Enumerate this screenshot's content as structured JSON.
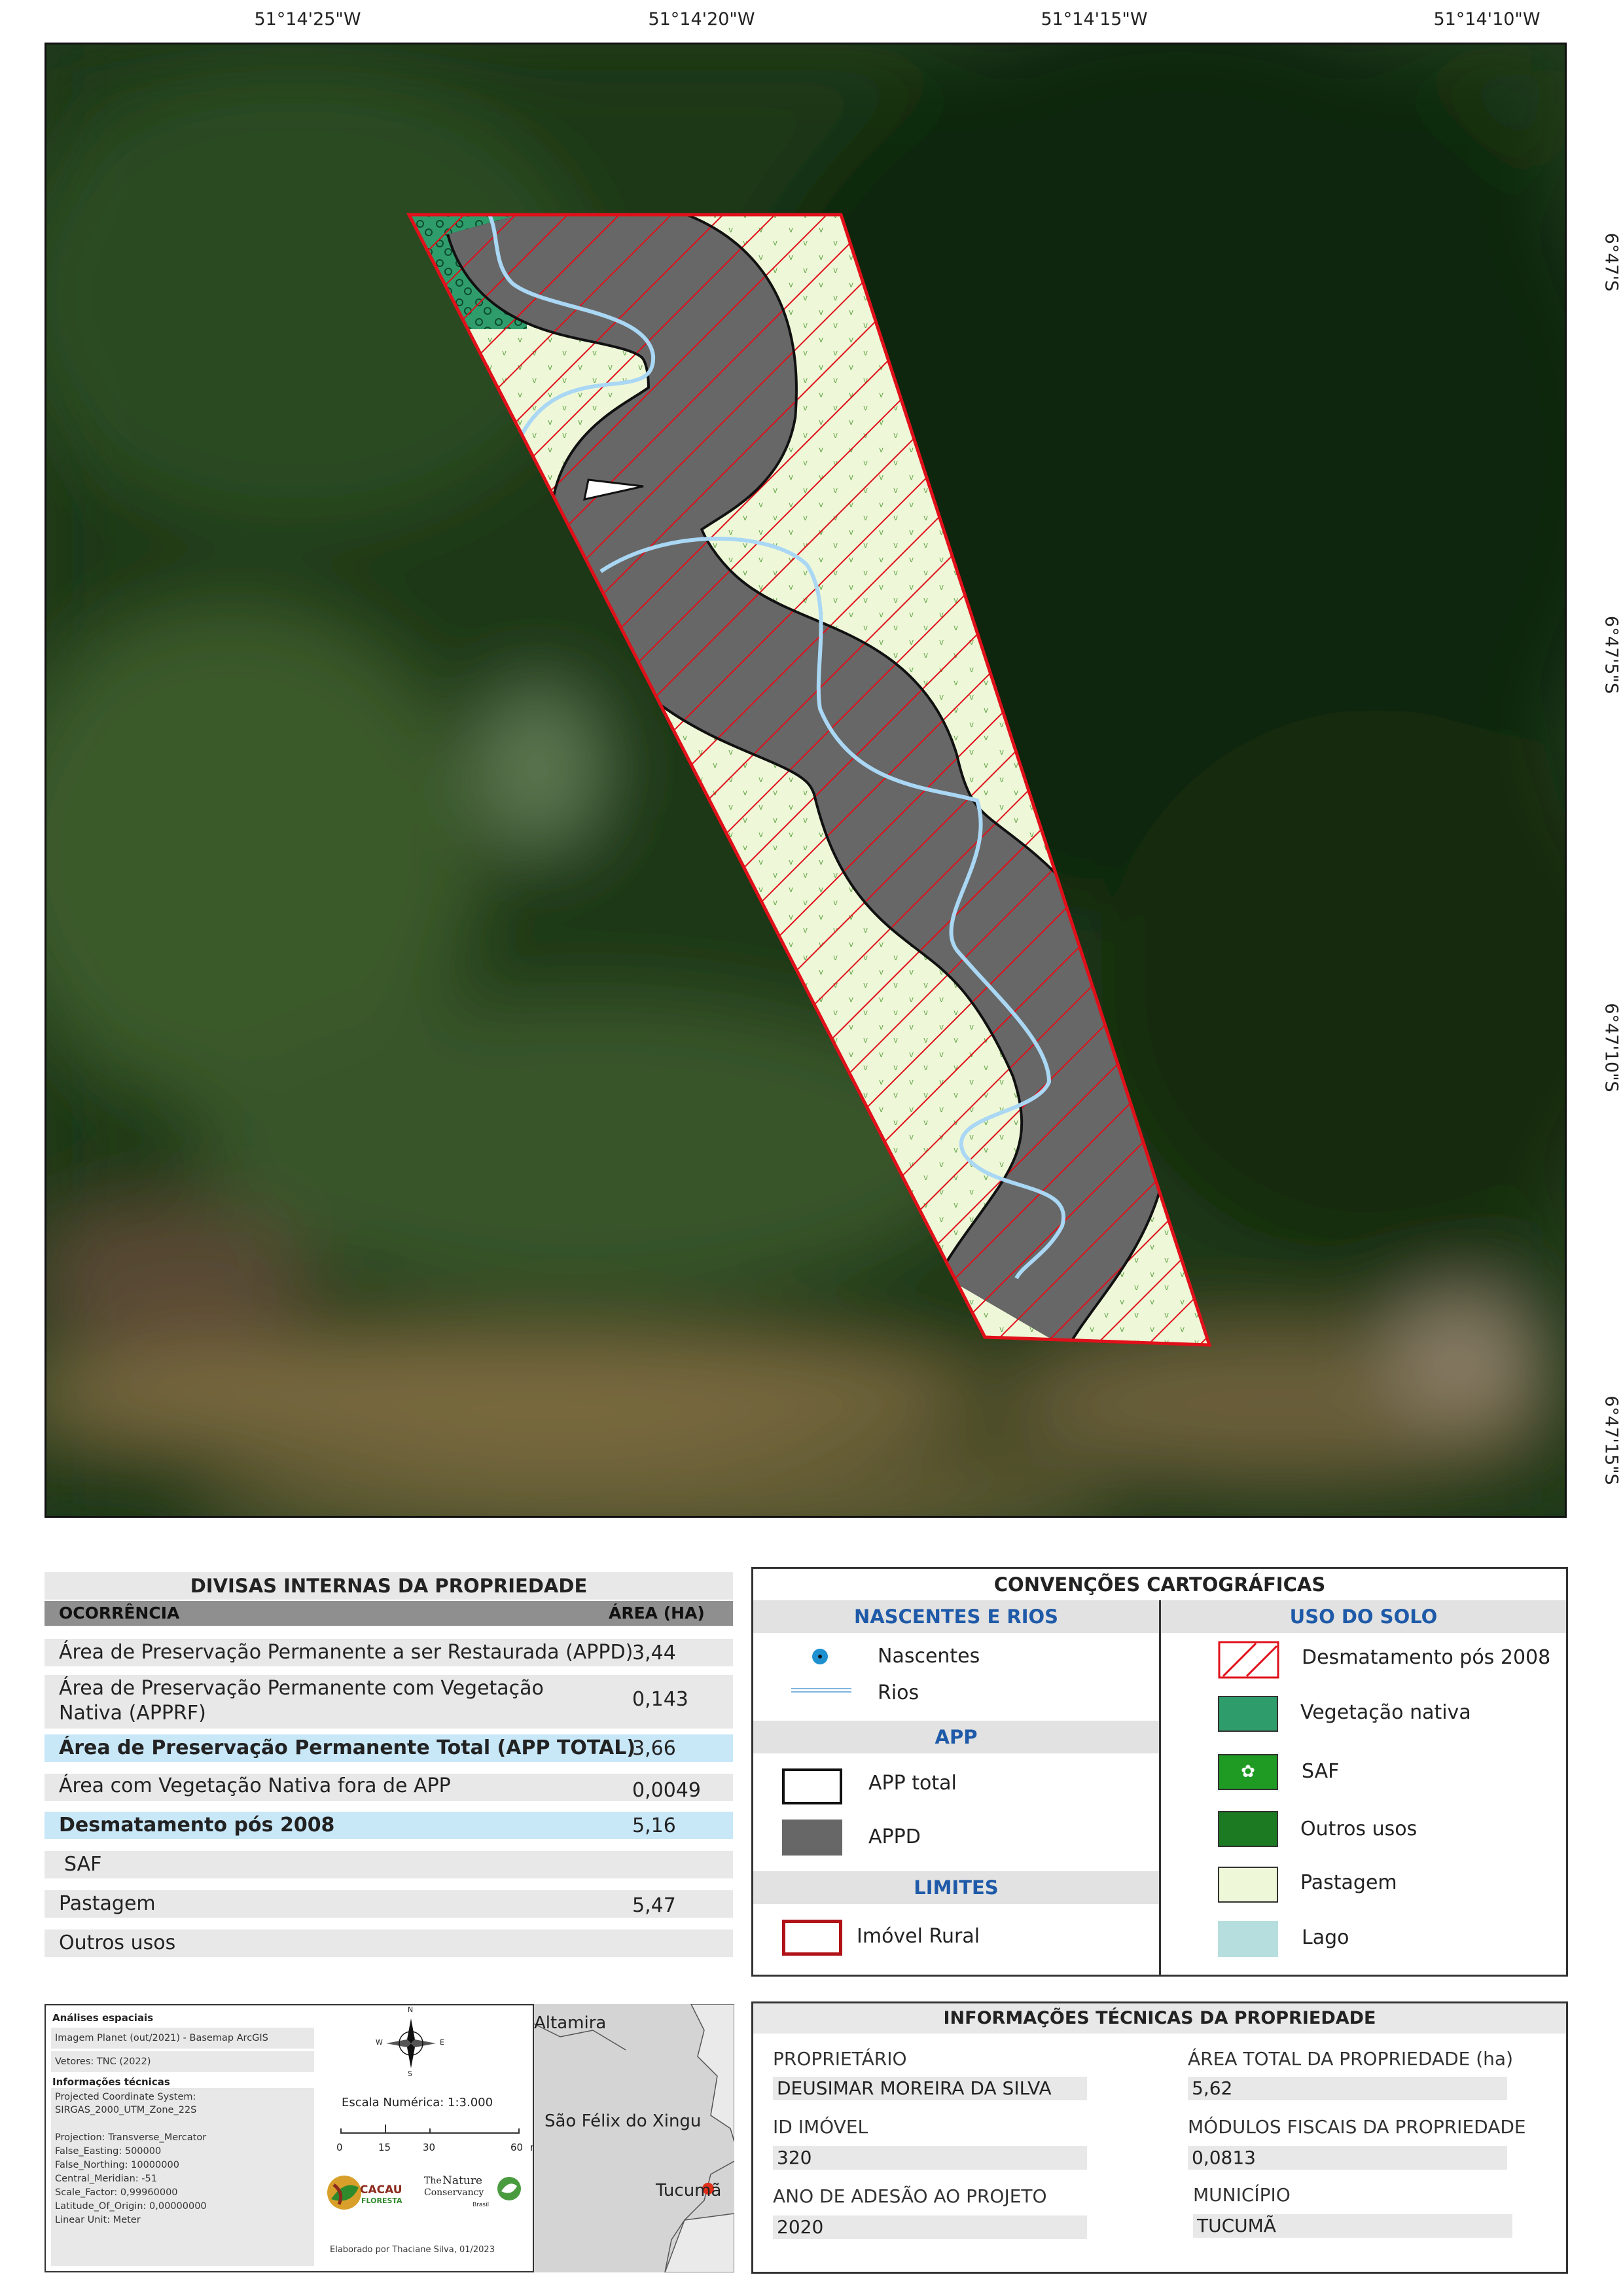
{
  "coordinates": {
    "longitude_labels": [
      "51°14'25\"W",
      "51°14'20\"W",
      "51°14'15\"W",
      "51°14'10\"W"
    ],
    "latitude_labels": [
      "6°47'S",
      "6°47'5\"S",
      "6°47'10\"S",
      "6°47'15\"S"
    ]
  },
  "divisas": {
    "title": "DIVISAS INTERNAS DA PROPRIEDADE",
    "col_ocorrencia": "OCORRÊNCIA",
    "col_area": "ÁREA (HA)",
    "rows": [
      {
        "label": "Área de Preservação Permanente a ser Restaurada (APPD)",
        "value": "3,44"
      },
      {
        "label": "Área de Preservação Permanente com Vegetação Nativa (APPRF)",
        "value": "0,143"
      },
      {
        "label": "Área de Preservação Permanente Total (APP TOTAL)",
        "value": "3,66"
      },
      {
        "label": "Área com Vegetação Nativa fora de APP",
        "value": "0,0049"
      },
      {
        "label": "Desmatamento pós 2008",
        "value": "5,16"
      },
      {
        "label": "SAF",
        "value": ""
      },
      {
        "label": "Pastagem",
        "value": "5,47"
      },
      {
        "label": "Outros usos",
        "value": ""
      }
    ]
  },
  "convencoes": {
    "title": "CONVENÇÕES CARTOGRÁFICAS",
    "nascentes_rios": "NASCENTES E RIOS",
    "nascentes": "Nascentes",
    "rios": "Rios",
    "app": "APP",
    "app_total": "APP total",
    "appd": "APPD",
    "limites": "LIMITES",
    "imovel_rural": "Imóvel Rural",
    "uso_do_solo": "USO DO SOLO",
    "uso_items": [
      "Desmatamento pós 2008",
      "Vegetação nativa",
      "SAF",
      "Outros usos",
      "Pastagem",
      "Lago"
    ]
  },
  "analises": {
    "title": "Análises espaciais",
    "imagem": "Imagem Planet (out/2021) - Basemap ArcGIS",
    "vetores": "Vetores: TNC (2022)",
    "info_title": "Informações técnicas",
    "pcs_label": "Projected Coordinate System:",
    "pcs_value": "SIRGAS_2000_UTM_Zone_22S",
    "projection": "Projection: Transverse_Mercator",
    "false_easting": "False_Easting: 500000",
    "false_northing": "False_Northing: 10000000",
    "central_meridian": "Central_Meridian: -51",
    "scale_factor": "Scale_Factor: 0,99960000",
    "latitude_origin": "Latitude_Of_Origin: 0,00000000",
    "linear_unit": "Linear Unit:  Meter",
    "escala": "Escala Numérica: 1:3.000",
    "scale_ticks": [
      "0",
      "15",
      "30",
      "60"
    ],
    "scale_unit": "m",
    "elaborado": "Elaborado por Thaciane Silva, 01/2023",
    "logo_cacau_1": "CACAU",
    "logo_cacau_2": "FLORESTA",
    "logo_tnc_1": "The",
    "logo_tnc_2": "Nature",
    "logo_tnc_3": "Conservancy",
    "logo_tnc_4": "Brasil",
    "compass": {
      "n": "N",
      "s": "S",
      "e": "E",
      "w": "W"
    },
    "locator_places": [
      "Altamira",
      "São Félix do Xingu",
      "Tucumã"
    ]
  },
  "info": {
    "title": "INFORMAÇÕES TÉCNICAS DA PROPRIEDADE",
    "proprietario_label": "PROPRIETÁRIO",
    "proprietario": "DEUSIMAR MOREIRA DA SILVA",
    "id_label": "ID IMÓVEL",
    "id": "320",
    "ano_label": "ANO DE ADESÃO AO PROJETO",
    "ano": "2020",
    "area_label": "ÁREA TOTAL DA PROPRIEDADE (ha)",
    "area": "5,62",
    "modulos_label": "MÓDULOS FISCAIS DA PROPRIEDADE",
    "modulos": "0,0813",
    "municipio_label": "MUNICÍPIO",
    "municipio": "TUCUMÃ"
  },
  "colors": {
    "deforestation": "#e0101a",
    "appd": "#676767",
    "pasture": "#eef8d8",
    "native_veg": "#2f9c6c",
    "river": "#a9d7f4",
    "highlight": "#c8e7f7",
    "header_blue": "#1e5aa8"
  }
}
